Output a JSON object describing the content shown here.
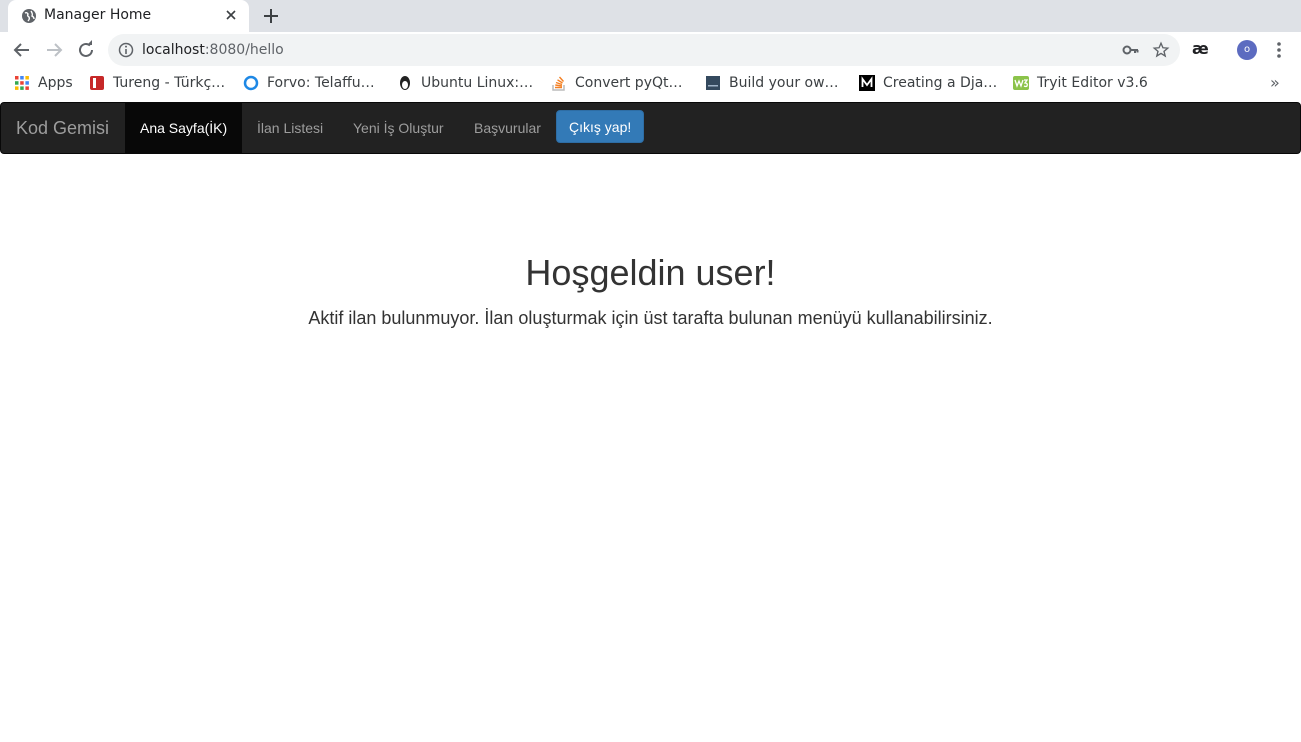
{
  "browser": {
    "tab_title": "Manager Home",
    "url_host": "localhost",
    "url_rest": ":8080/hello",
    "extension_label": "æ",
    "profile_initial": "o",
    "bookmarks": [
      {
        "label": "Apps",
        "icon": "apps-grid-icon"
      },
      {
        "label": "Tureng - Türkç…",
        "icon": "tureng-icon"
      },
      {
        "label": "Forvo: Telaffu…",
        "icon": "forvo-icon"
      },
      {
        "label": "Ubuntu Linux:…",
        "icon": "ubuntu-icon"
      },
      {
        "label": "Convert pyQt…",
        "icon": "stackoverflow-icon"
      },
      {
        "label": "Build your ow…",
        "icon": "book-icon"
      },
      {
        "label": "Creating a Dja…",
        "icon": "medium-icon"
      },
      {
        "label": "Tryit Editor v3.6",
        "icon": "w3schools-icon"
      }
    ],
    "bookmarks_overflow": "»"
  },
  "navbar": {
    "brand": "Kod Gemisi",
    "items": [
      {
        "label": "Ana Sayfa(İK)",
        "active": true
      },
      {
        "label": "İlan Listesi",
        "active": false
      },
      {
        "label": "Yeni İş Oluştur",
        "active": false
      },
      {
        "label": "Başvurular",
        "active": false
      }
    ],
    "logout_label": "Çıkış yap!"
  },
  "main": {
    "heading": "Hoşgeldin user!",
    "message": "Aktif ilan bulunmuyor. İlan oluşturmak için üst tarafta bulunan menüyü kullanabilirsiniz."
  },
  "colors": {
    "navbar_bg": "#222222",
    "navbar_active_bg": "#080808",
    "primary_button": "#337ab7",
    "tabstrip_bg": "#dee1e6",
    "avatar_bg": "#5c6bc0"
  }
}
